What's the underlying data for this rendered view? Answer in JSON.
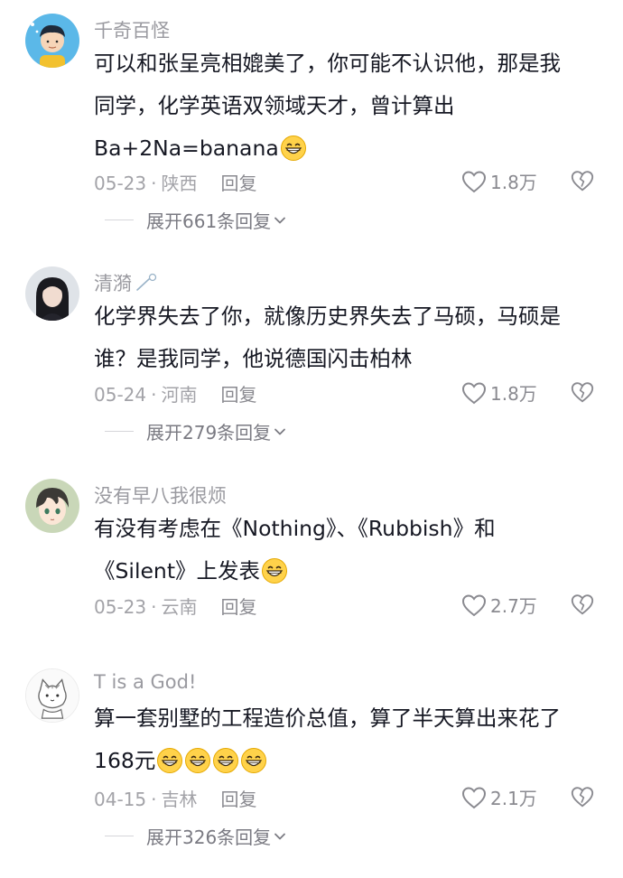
{
  "comments": [
    {
      "username": "千奇百怪",
      "lines": [
        "可以和张呈亮相媲美了，你可能不认识他，那是我",
        "同学，化学英语双领域天才，曾计算出",
        "Ba+2Na=banana"
      ],
      "date": "05-23",
      "location": "陕西",
      "reply_label": "回复",
      "likes": "1.8万",
      "expand_label": "展开661条回复"
    },
    {
      "username": "清漪",
      "lines": [
        "化学界失去了你，就像历史界失去了马硕，马硕是",
        "谁？是我同学，他说德国闪击柏林"
      ],
      "date": "05-24",
      "location": "河南",
      "reply_label": "回复",
      "likes": "1.8万",
      "expand_label": "展开279条回复"
    },
    {
      "username": "没有早八我很烦",
      "lines": [
        "有没有考虑在《Nothing》、《Rubbish》和",
        "《Silent》上发表"
      ],
      "date": "05-23",
      "location": "云南",
      "reply_label": "回复",
      "likes": "2.7万"
    },
    {
      "username": "T is a God!",
      "lines": [
        "算一套别墅的工程造价总值，算了半天算出来花了",
        "168元"
      ],
      "date": "04-15",
      "location": "吉林",
      "reply_label": "回复",
      "likes": "2.1万",
      "expand_label": "展开326条回复"
    }
  ],
  "colors": {
    "text": "#161823",
    "muted": "#a3a3a8",
    "username": "#9a9aa0",
    "emoji_face": "#ffd24a"
  },
  "icons": [
    "grin-emoji",
    "heart-outline-icon",
    "broken-heart-icon",
    "chevron-down-icon"
  ]
}
